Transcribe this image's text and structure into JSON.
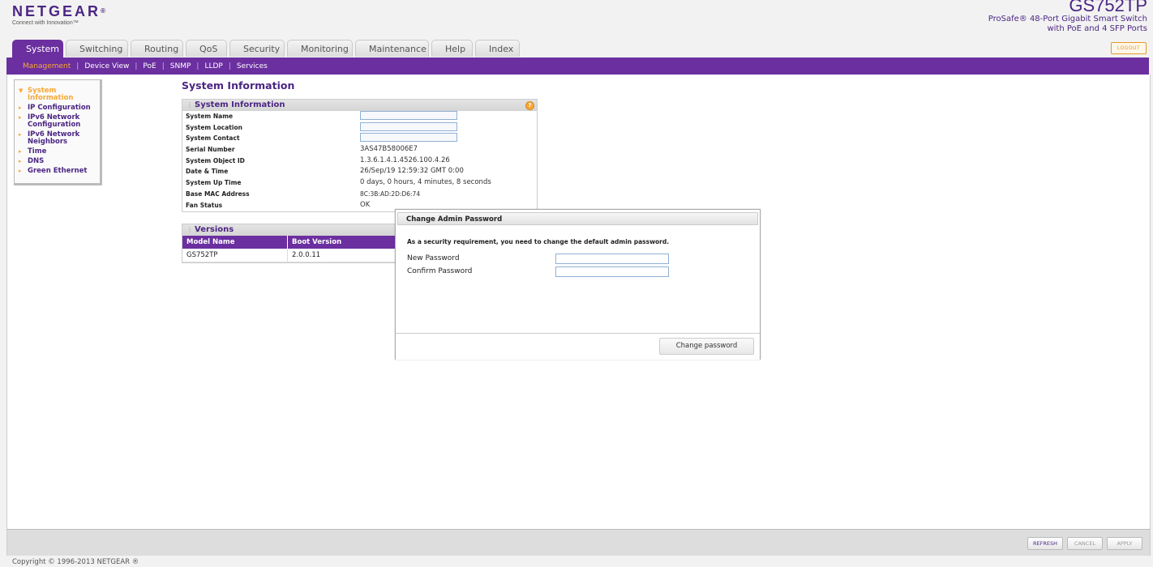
{
  "brand": {
    "name": "NETGEAR",
    "tagline": "Connect with Innovation™",
    "reg": "®"
  },
  "product": {
    "model": "GS752TP",
    "desc1": "ProSafe® 48-Port Gigabit Smart Switch",
    "desc2": "with PoE and 4 SFP Ports"
  },
  "logout_label": "LOGOUT",
  "tabs": [
    "System",
    "Switching",
    "Routing",
    "QoS",
    "Security",
    "Monitoring",
    "Maintenance",
    "Help",
    "Index"
  ],
  "subnav": [
    "Management",
    "Device View",
    "PoE",
    "SNMP",
    "LLDP",
    "Services"
  ],
  "sidebar": [
    {
      "l1": "System",
      "l2": "Information",
      "active": true
    },
    {
      "l1": "IP Configuration",
      "l2": ""
    },
    {
      "l1": "IPv6 Network",
      "l2": "Configuration"
    },
    {
      "l1": "IPv6 Network",
      "l2": "Neighbors"
    },
    {
      "l1": "Time",
      "l2": ""
    },
    {
      "l1": "DNS",
      "l2": ""
    },
    {
      "l1": "Green Ethernet",
      "l2": ""
    }
  ],
  "page_title": "System Information",
  "sysinfo": {
    "title": "System Information",
    "help": "?",
    "rows": [
      {
        "label": "System Name",
        "value": "",
        "input": true
      },
      {
        "label": "System Location",
        "value": "",
        "input": true
      },
      {
        "label": "System Contact",
        "value": "",
        "input": true
      },
      {
        "label": "Serial Number",
        "value": "3AS47B58006E7"
      },
      {
        "label": "System Object ID",
        "value": "1.3.6.1.4.1.4526.100.4.26"
      },
      {
        "label": "Date & Time",
        "value": "26/Sep/19 12:59:32 GMT 0:00"
      },
      {
        "label": "System Up Time",
        "value": "0 days, 0 hours, 4 minutes, 8 seconds"
      },
      {
        "label": "Base MAC Address",
        "value": "8C:3B:AD:2D:D6:74"
      },
      {
        "label": "Fan Status",
        "value": "OK"
      }
    ]
  },
  "versions": {
    "title": "Versions",
    "headers": [
      "Model Name",
      "Boot Version"
    ],
    "row": [
      "GS752TP",
      "2.0.0.11"
    ]
  },
  "footer": {
    "refresh": "REFRESH",
    "cancel": "CANCEL",
    "apply": "APPLY"
  },
  "copyright": "Copyright © 1996-2013 NETGEAR ®",
  "modal": {
    "title": "Change Admin Password",
    "message": "As a security requirement, you need to change the default admin password.",
    "new_label": "New Password",
    "confirm_label": "Confirm Password",
    "button": "Change password"
  }
}
